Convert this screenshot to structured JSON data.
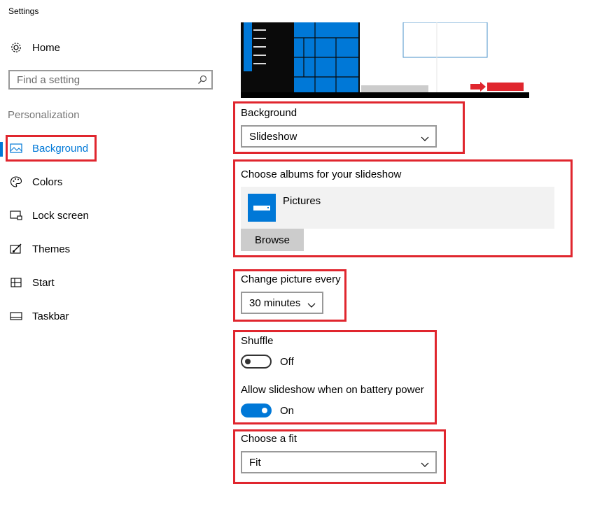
{
  "window": {
    "title": "Settings"
  },
  "sidebar": {
    "home": {
      "label": "Home",
      "icon": "gear-icon"
    },
    "search": {
      "placeholder": "Find a setting",
      "icon": "search-icon"
    },
    "section": "Personalization",
    "items": [
      {
        "label": "Background",
        "icon": "picture-icon",
        "active": true
      },
      {
        "label": "Colors",
        "icon": "palette-icon"
      },
      {
        "label": "Lock screen",
        "icon": "lock-screen-icon"
      },
      {
        "label": "Themes",
        "icon": "brush-icon"
      },
      {
        "label": "Start",
        "icon": "start-grid-icon"
      },
      {
        "label": "Taskbar",
        "icon": "taskbar-icon"
      }
    ]
  },
  "main": {
    "background": {
      "label": "Background",
      "value": "Slideshow"
    },
    "albums": {
      "label": "Choose albums for your slideshow",
      "album": "Pictures",
      "browse": "Browse"
    },
    "interval": {
      "label": "Change picture every",
      "value": "30 minutes"
    },
    "shuffle": {
      "label": "Shuffle",
      "state": "Off"
    },
    "battery": {
      "label": "Allow slideshow when on battery power",
      "state": "On"
    },
    "fit": {
      "label": "Choose a fit",
      "value": "Fit"
    }
  },
  "colors": {
    "accent": "#0078d7",
    "highlight": "#e0262e"
  }
}
